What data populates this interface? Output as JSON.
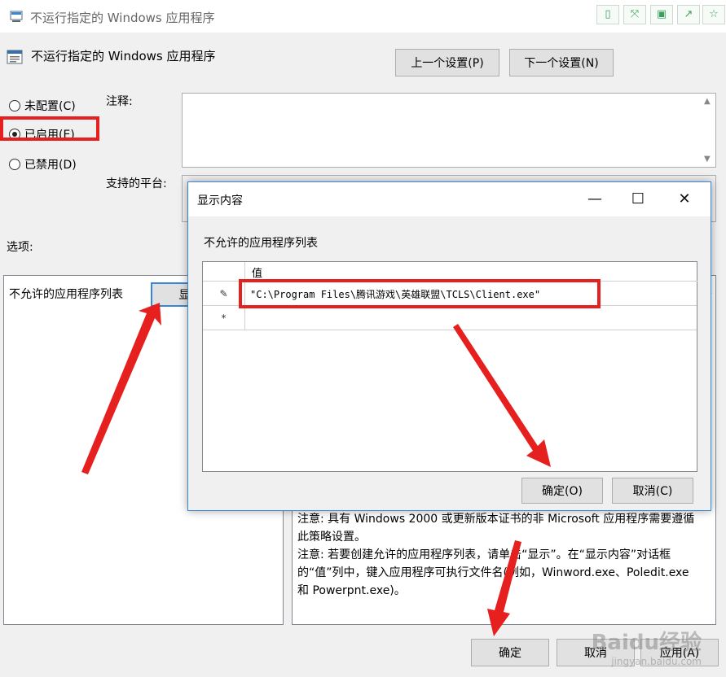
{
  "window": {
    "title": "不运行指定的 Windows 应用程序",
    "toolbar_icons": [
      "phone-icon",
      "expand-icon",
      "save-icon",
      "share-icon",
      "star-icon"
    ]
  },
  "header": {
    "policy_title": "不运行指定的 Windows 应用程序",
    "prev_button": "上一个设置(P)",
    "next_button": "下一个设置(N)"
  },
  "state": {
    "not_configured": "未配置(C)",
    "enabled": "已启用(E)",
    "disabled": "已禁用(D)",
    "selected": "enabled"
  },
  "labels": {
    "comment": "注释:",
    "platform": "支持的平台:",
    "options": "选项:"
  },
  "options_panel": {
    "list_label": "不允许的应用程序列表",
    "show_button": "显示..."
  },
  "help_panel": {
    "text": "注意: 具有 Windows 2000 或更新版本证书的非 Microsoft 应用程序需要遵循此策略设置。\n注意: 若要创建允许的应用程序列表，请单击“显示”。在“显示内容”对话框的“值”列中，键入应用程序可执行文件名(例如，Winword.exe、Poledit.exe 和 Powerpnt.exe)。"
  },
  "footer": {
    "ok": "确定",
    "cancel": "取消",
    "apply": "应用(A)"
  },
  "dialog": {
    "title": "显示内容",
    "heading": "不允许的应用程序列表",
    "column_header": "值",
    "rows": [
      {
        "marker": "✎",
        "value": "\"C:\\Program Files\\腾讯游戏\\英雄联盟\\TCLS\\Client.exe\""
      },
      {
        "marker": "*",
        "value": ""
      }
    ],
    "ok_button": "确定(O)",
    "cancel_button": "取消(C)"
  },
  "watermark": {
    "brand": "Baidu经验",
    "url": "jingyan.baidu.com"
  },
  "colors": {
    "highlight_red": "#e5201f",
    "dialog_border": "#3a86d6",
    "toolbar_green": "#3aa05a"
  }
}
